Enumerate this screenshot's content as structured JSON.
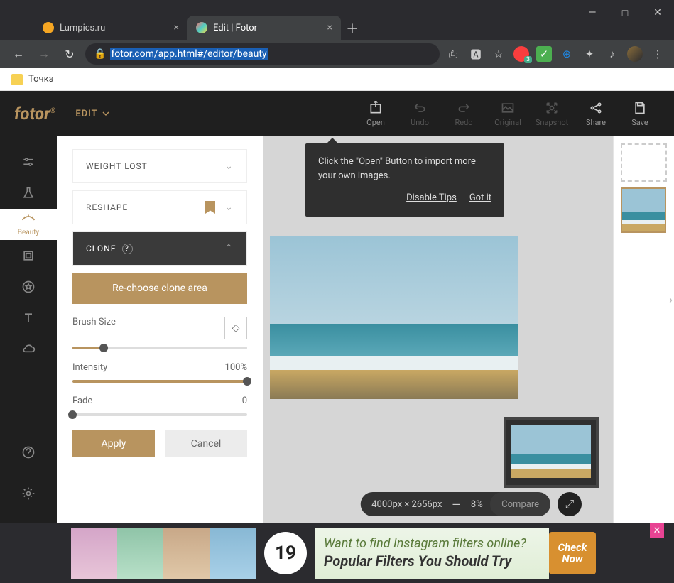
{
  "window": {
    "minimize": "—",
    "maximize": "□",
    "close": "✕"
  },
  "tabs": [
    {
      "title": "Lumpics.ru",
      "fav": "#f5a623"
    },
    {
      "title": "Edit | Fotor",
      "fav": "#ff6b6b"
    }
  ],
  "newtab": "＋",
  "nav": {
    "back": "←",
    "forward": "→",
    "reload": "↻"
  },
  "url": {
    "lock": "🔒",
    "host": "fotor.com",
    "path": "/app.html#/editor/beauty"
  },
  "ext": {
    "cast": "⬚",
    "translate": "⬚",
    "star": "☆",
    "check": "✓",
    "globe": "🌐",
    "puzzle": "✦",
    "list": "≡",
    "menu": "⋮"
  },
  "bookmarks": {
    "label": "Точка"
  },
  "logo": "fotor",
  "edit_label": "EDIT",
  "top_tools": [
    {
      "name": "open",
      "label": "Open",
      "disabled": false
    },
    {
      "name": "undo",
      "label": "Undo",
      "disabled": true
    },
    {
      "name": "redo",
      "label": "Redo",
      "disabled": true
    },
    {
      "name": "original",
      "label": "Original",
      "disabled": true
    },
    {
      "name": "snapshot",
      "label": "Snapshot",
      "disabled": true
    },
    {
      "name": "share",
      "label": "Share",
      "disabled": false
    },
    {
      "name": "save",
      "label": "Save",
      "disabled": false
    }
  ],
  "sidebar_active": "Beauty",
  "panel": {
    "weight_lost": "WEIGHT LOST",
    "reshape": "RESHAPE",
    "clone": "CLONE",
    "rechoose": "Re-choose clone area",
    "brush_label": "Brush Size",
    "intensity_label": "Intensity",
    "intensity_value": "100%",
    "fade_label": "Fade",
    "fade_value": "0",
    "apply": "Apply",
    "cancel": "Cancel"
  },
  "slider": {
    "brush": 18,
    "intensity": 100,
    "fade": 0
  },
  "hint": {
    "text": "Click the \"Open\" Button to import more your own images.",
    "disable": "Disable Tips",
    "got": "Got it"
  },
  "zoom": {
    "dims": "4000px × 2656px",
    "minus": "—",
    "pct": "8%",
    "plus": "＋"
  },
  "compare": "Compare",
  "ad": {
    "num": "19",
    "l1": "Want to find Instagram filters online?",
    "l2": "Popular Filters You Should Try",
    "btn1": "Check",
    "btn2": "Now"
  }
}
